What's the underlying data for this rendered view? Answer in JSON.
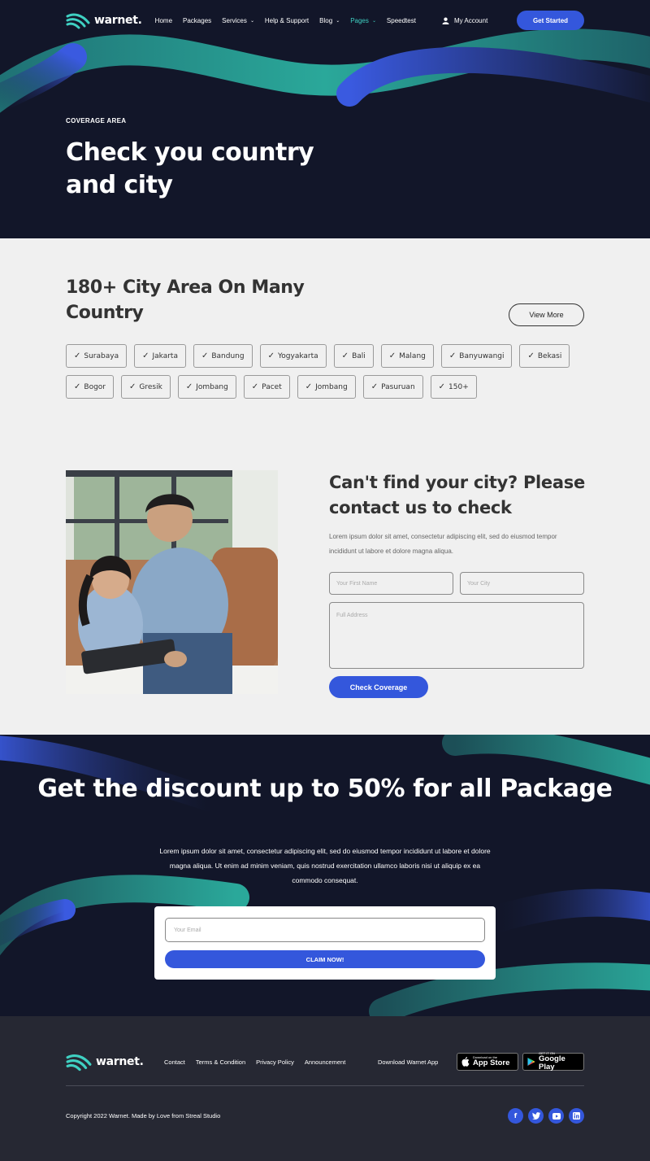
{
  "brand": {
    "name": "warnet.",
    "accent": "#3457dc",
    "teal": "#2a9d8f",
    "dark": "#121629"
  },
  "nav": {
    "items": [
      {
        "label": "Home"
      },
      {
        "label": "Packages"
      },
      {
        "label": "Services",
        "caret": "⌄"
      },
      {
        "label": "Help & Support"
      },
      {
        "label": "Blog",
        "caret": "⌄"
      },
      {
        "label": "Pages",
        "caret": "⌄"
      },
      {
        "label": "Speedtest"
      }
    ],
    "account_label": "My Account",
    "account_icon": "user-icon",
    "cta_label": "Get Started"
  },
  "hero": {
    "eyebrow": "COVERAGE AREA",
    "title": "Check you country and city"
  },
  "cities": {
    "title": "180+ City Area On Many Country",
    "view_more_label": "View More",
    "row1": [
      "Surabaya",
      "Jakarta",
      "Bandung",
      "Yogyakarta",
      "Bali",
      "Malang",
      "Banyuwangi",
      "Bekasi"
    ],
    "row2": [
      "Bogor",
      "Gresik",
      "Jombang",
      "Pacet",
      "Jombang",
      "Pasuruan",
      "150+"
    ]
  },
  "contact": {
    "title": "Can't find your city? Please contact us to check",
    "description": "Lorem ipsum dolor sit amet, consectetur adipiscing elit, sed do eiusmod tempor incididunt ut labore et dolore magna aliqua.",
    "first_name_placeholder": "Your First Name",
    "city_placeholder": "Your City",
    "address_placeholder": "Full Address",
    "submit_label": "Check Coverage"
  },
  "promo": {
    "title": "Get the discount up to 50% for all Package",
    "description": "Lorem ipsum dolor sit amet, consectetur adipiscing elit, sed do eiusmod tempor incididunt ut labore et dolore magna aliqua. Ut enim ad minim veniam, quis nostrud exercitation ullamco laboris nisi ut aliquip ex ea commodo consequat.",
    "email_placeholder": "Your Email",
    "claim_label": "CLAIM NOW!"
  },
  "footer": {
    "links": [
      "Contact",
      "Terms & Condition",
      "Privacy Policy",
      "Announcement"
    ],
    "download_label": "Download Warnet App",
    "app_store": {
      "small": "Download on the",
      "big": "App Store"
    },
    "google_play": {
      "small": "GET IT ON",
      "big": "Google Play"
    },
    "copyright": "Copyright 2022 Warnet. Made by Love from Streal Studio",
    "socials": [
      "facebook-icon",
      "twitter-icon",
      "youtube-icon",
      "linkedin-icon"
    ]
  }
}
